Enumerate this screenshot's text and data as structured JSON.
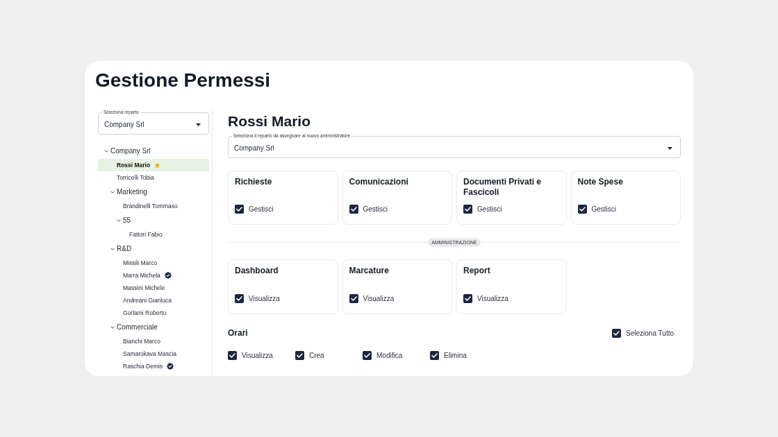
{
  "page_title": "Gestione Permessi",
  "sidebar": {
    "department_select": {
      "label": "Seleziona reparto",
      "value": "Company Srl"
    },
    "tree": [
      {
        "kind": "group",
        "label": "Company Srl",
        "expanded": true,
        "selected": false,
        "children": [
          {
            "kind": "person",
            "label": "Rossi Mario",
            "selected": true,
            "starred": true,
            "verified": false
          },
          {
            "kind": "person",
            "label": "Torricelli Tobia",
            "selected": false,
            "starred": false,
            "verified": false
          },
          {
            "kind": "group",
            "label": "Marketing",
            "expanded": true,
            "selected": false,
            "children": [
              {
                "kind": "person",
                "label": "Brandinelli Tommaso",
                "selected": false,
                "starred": false,
                "verified": false
              },
              {
                "kind": "group",
                "label": "55",
                "expanded": true,
                "selected": false,
                "children": [
                  {
                    "kind": "person",
                    "label": "Fattori Fabio",
                    "selected": false,
                    "starred": false,
                    "verified": false
                  }
                ]
              }
            ]
          },
          {
            "kind": "group",
            "label": "R&D",
            "expanded": true,
            "selected": false,
            "children": [
              {
                "kind": "person",
                "label": "Missili Marco",
                "selected": false,
                "starred": false,
                "verified": false
              },
              {
                "kind": "person",
                "label": "Marra Michela",
                "selected": false,
                "starred": false,
                "verified": true
              },
              {
                "kind": "person",
                "label": "Massini Michele",
                "selected": false,
                "starred": false,
                "verified": false
              },
              {
                "kind": "person",
                "label": "Andreani Gianluca",
                "selected": false,
                "starred": false,
                "verified": false
              },
              {
                "kind": "person",
                "label": "Gorlami Roberto",
                "selected": false,
                "starred": false,
                "verified": false
              }
            ]
          },
          {
            "kind": "group",
            "label": "Commerciale",
            "expanded": true,
            "selected": false,
            "children": [
              {
                "kind": "person",
                "label": "Bianchi Marco",
                "selected": false,
                "starred": false,
                "verified": false
              },
              {
                "kind": "person",
                "label": "Samarokava Mascia",
                "selected": false,
                "starred": false,
                "verified": false
              },
              {
                "kind": "person",
                "label": "Raschia Demis",
                "selected": false,
                "starred": false,
                "verified": true
              }
            ]
          }
        ]
      }
    ]
  },
  "detail": {
    "title": "Rossi Mario",
    "department_select": {
      "label": "Seleziona il reparto da assegnare al nuovo amministratore",
      "value": "Company Srl"
    },
    "permission_cards": [
      {
        "title": "Richieste",
        "option": {
          "label": "Gestisci",
          "checked": true
        }
      },
      {
        "title": "Comunicazioni",
        "option": {
          "label": "Gestisci",
          "checked": true
        }
      },
      {
        "title": "Documenti Privati e Fascicoli",
        "option": {
          "label": "Gestisci",
          "checked": true
        }
      },
      {
        "title": "Note Spese",
        "option": {
          "label": "Gestisci",
          "checked": true
        }
      }
    ],
    "section_label": "AMMINISTRAZIONE",
    "admin_cards": [
      {
        "title": "Dashboard",
        "option": {
          "label": "Visualizza",
          "checked": true
        }
      },
      {
        "title": "Marcature",
        "option": {
          "label": "Visualizza",
          "checked": true
        }
      },
      {
        "title": "Report",
        "option": {
          "label": "Visualizza",
          "checked": true
        }
      }
    ],
    "schedule": {
      "title": "Orari",
      "select_all": {
        "label": "Seleziona Tutto",
        "checked": true
      },
      "options": [
        {
          "label": "Visualizza",
          "checked": true
        },
        {
          "label": "Crea",
          "checked": true
        },
        {
          "label": "Modifica",
          "checked": true
        },
        {
          "label": "Elimina",
          "checked": true
        }
      ]
    }
  }
}
